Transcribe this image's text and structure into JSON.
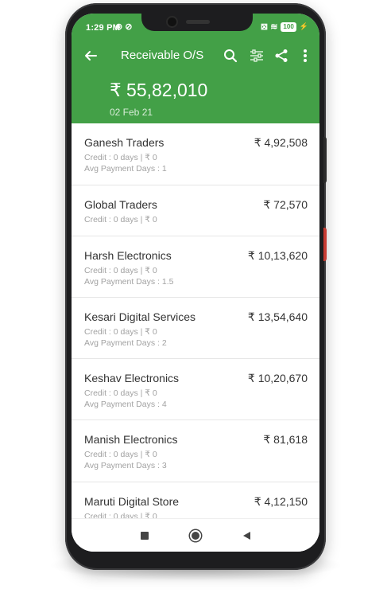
{
  "status_bar": {
    "time": "1:29 PM",
    "left_icons": "⊚ ⊘",
    "right_icons": "⊠ ≋",
    "battery": "100",
    "battery_bolt": "⚡"
  },
  "app_bar": {
    "title": "Receivable O/S",
    "back_icon": "arrow-left-icon",
    "search_icon": "search-icon",
    "filter_icon": "sliders-icon",
    "share_icon": "share-icon",
    "more_icon": "more-vert-icon"
  },
  "summary": {
    "total": "₹ 55,82,010",
    "date": "02 Feb 21"
  },
  "colors": {
    "header_green": "#43a047",
    "text_dark": "#333333",
    "text_muted": "#a2a2a2"
  },
  "customers": [
    {
      "name": "Ganesh Traders",
      "amount": "₹ 4,92,508",
      "credit": "Credit : 0 days | ₹ 0",
      "avg": "Avg Payment Days : 1"
    },
    {
      "name": "Global Traders",
      "amount": "₹ 72,570",
      "credit": "Credit : 0 days | ₹ 0",
      "avg": ""
    },
    {
      "name": "Harsh Electronics",
      "amount": "₹ 10,13,620",
      "credit": "Credit : 0 days | ₹ 0",
      "avg": "Avg Payment Days : 1.5"
    },
    {
      "name": "Kesari Digital Services",
      "amount": "₹ 13,54,640",
      "credit": "Credit : 0 days | ₹ 0",
      "avg": "Avg Payment Days : 2"
    },
    {
      "name": "Keshav Electronics",
      "amount": "₹ 10,20,670",
      "credit": "Credit : 0 days | ₹ 0",
      "avg": "Avg Payment Days : 4"
    },
    {
      "name": "Manish Electronics",
      "amount": "₹ 81,618",
      "credit": "Credit : 0 days | ₹ 0",
      "avg": "Avg Payment Days : 3"
    },
    {
      "name": "Maruti Digital Store",
      "amount": "₹ 4,12,150",
      "credit": "Credit : 0 days | ₹ 0",
      "avg": ""
    }
  ],
  "nav_bar": {
    "recents_icon": "square-icon",
    "home_icon": "circle-icon",
    "back_icon": "triangle-back-icon"
  }
}
